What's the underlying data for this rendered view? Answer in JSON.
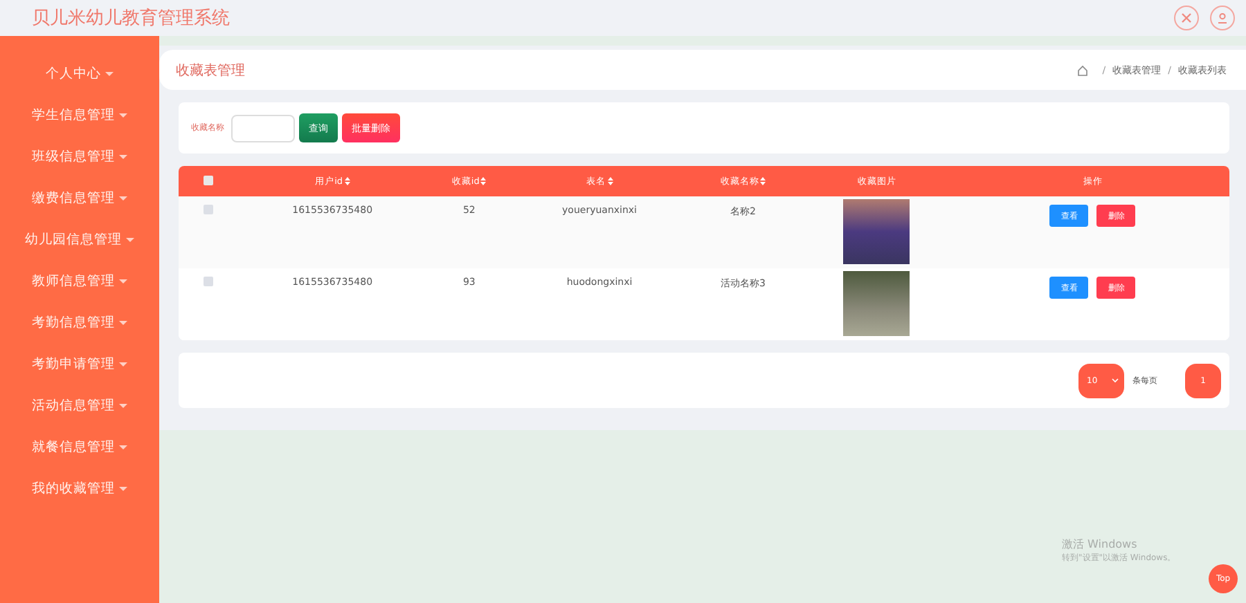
{
  "header": {
    "title": "贝儿米幼儿教育管理系统"
  },
  "sidebar": {
    "items": [
      {
        "label": "个人中心"
      },
      {
        "label": "学生信息管理"
      },
      {
        "label": "班级信息管理"
      },
      {
        "label": "缴费信息管理"
      },
      {
        "label": "幼儿园信息管理"
      },
      {
        "label": "教师信息管理"
      },
      {
        "label": "考勤信息管理"
      },
      {
        "label": "考勤申请管理"
      },
      {
        "label": "活动信息管理"
      },
      {
        "label": "就餐信息管理"
      },
      {
        "label": "我的收藏管理"
      }
    ]
  },
  "page_title": "收藏表管理",
  "breadcrumb": [
    {
      "separator": "/",
      "label": "收藏表管理"
    },
    {
      "separator": "/",
      "label": "收藏表列表"
    }
  ],
  "search": {
    "label": "收藏名称",
    "buttons": [
      {
        "label": "查询",
        "kind": "query"
      },
      {
        "label": "批量删除",
        "kind": "danger"
      }
    ]
  },
  "table": {
    "select_all": {
      "checked": false
    },
    "columns": [
      {
        "label": "用户id",
        "sortable": true
      },
      {
        "label": "收藏id",
        "sortable": true
      },
      {
        "label": "表名",
        "sortable": true
      },
      {
        "label": "收藏名称",
        "sortable": true
      },
      {
        "label": "收藏图片",
        "sortable": false
      },
      {
        "label": "操作",
        "sortable": false
      }
    ],
    "rows": [
      {
        "checked": false,
        "cells": [
          "1615536735480",
          "52",
          "youeryuanxinxi",
          "名称2"
        ],
        "actions": [
          "查看",
          "删除"
        ]
      },
      {
        "checked": false,
        "cells": [
          "1615536735480",
          "93",
          "huodongxinxi",
          "活动名称3"
        ],
        "actions": [
          "查看",
          "删除"
        ]
      }
    ]
  },
  "pagination": {
    "page_size": "10",
    "page_size_label": "条每页",
    "current_page": "1"
  },
  "windows_notice": {
    "title": "激活 Windows",
    "subtitle": "转到\"设置\"以激活 Windows。"
  },
  "top_button": "Top"
}
